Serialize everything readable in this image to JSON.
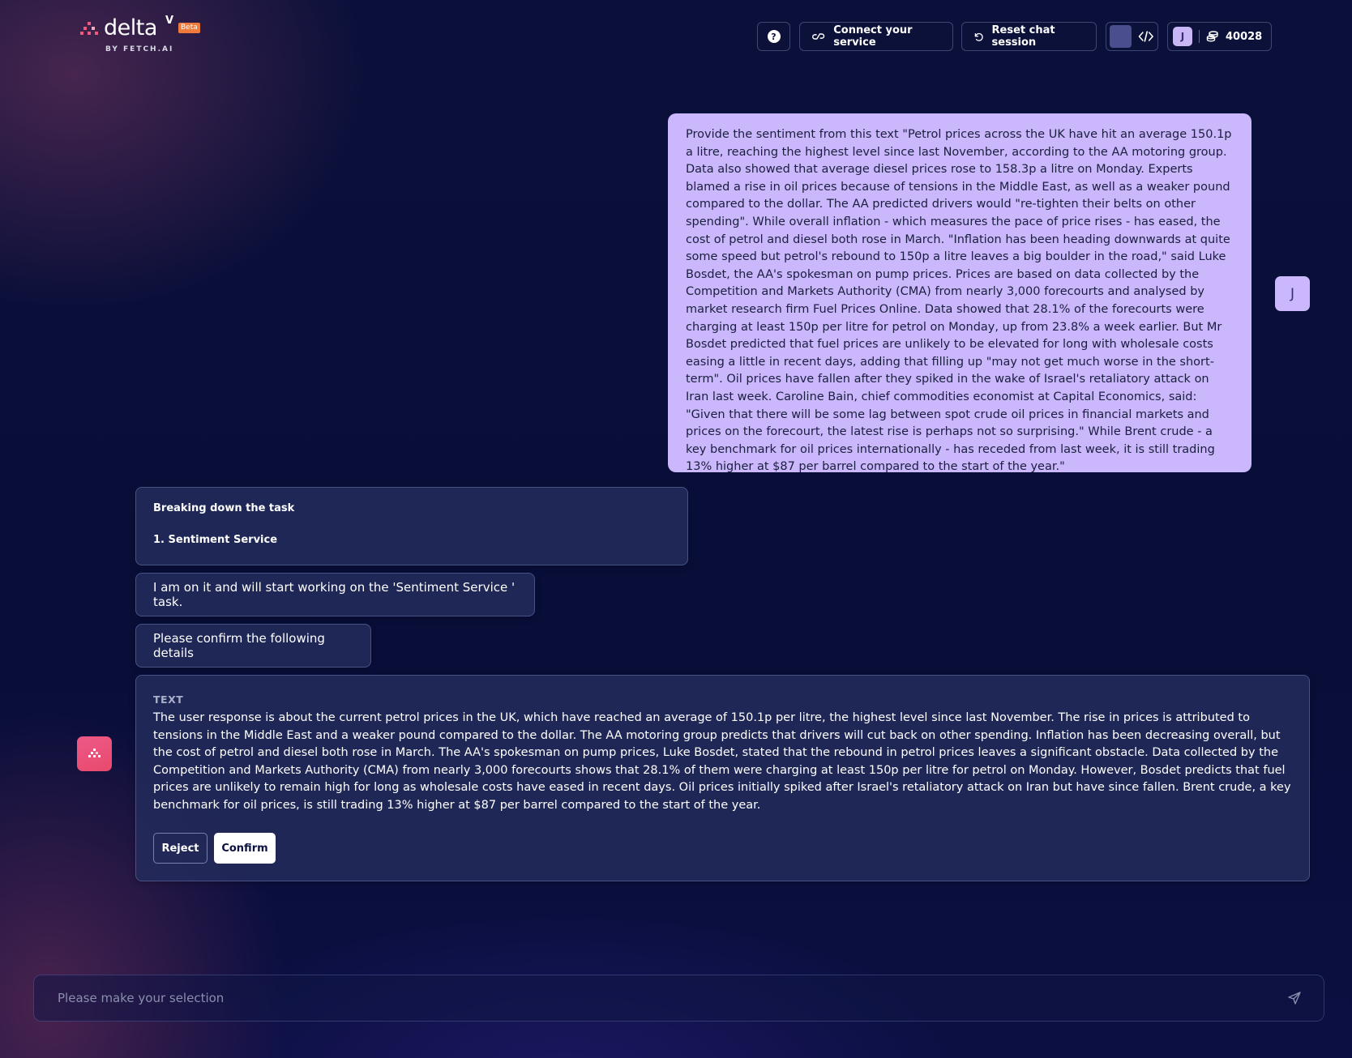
{
  "header": {
    "logo_word": "delta",
    "logo_sup": "V",
    "logo_badge": "Beta",
    "logo_byline": "BY FETCH.AI",
    "help_label": "?",
    "connect_label": "Connect your service",
    "reset_label": "Reset chat session",
    "user_initial": "J",
    "credits": "40028"
  },
  "conversation": {
    "user_message": "Provide the sentiment from this text \"Petrol prices across the UK have hit an average 150.1p a litre, reaching the highest level since last November, according to the AA motoring group. Data also showed that average diesel prices rose to 158.3p a litre on Monday. Experts blamed a rise in oil prices because of tensions in the Middle East, as well as a weaker pound compared to the dollar. The AA predicted drivers would \"re-tighten their belts on other spending\". While overall inflation - which measures the pace of price rises - has eased, the cost of petrol and diesel both rose in March. \"Inflation has been heading downwards at quite some speed but petrol's rebound to 150p a litre leaves a big boulder in the road,\" said Luke Bosdet, the AA's spokesman on pump prices. Prices are based on data collected by the Competition and Markets Authority (CMA) from nearly 3,000 forecourts and analysed by market research firm Fuel Prices Online. Data showed that 28.1% of the forecourts were charging at least 150p per litre for petrol on Monday, up from 23.8% a week earlier. But Mr Bosdet predicted that fuel prices are unlikely to be elevated for long with wholesale costs easing a little in recent days, adding that filling up \"may not get much worse in the short-term\". Oil prices have fallen after they spiked in the wake of Israel's retaliatory attack on Iran last week. Caroline Bain, chief commodities economist at Capital Economics, said: \"Given that there will be some lag between spot crude oil prices in financial markets and prices on the forecourt, the latest rise is perhaps not so surprising.\" While Brent crude - a key benchmark for oil prices internationally - has receded from last week, it is still trading 13% higher at $87 per barrel compared to the start of the year.\"",
    "user_avatar": "J",
    "breakdown_title": "Breaking down the task",
    "breakdown_item": "1. Sentiment Service",
    "working_message": "I am on it and will start working on the 'Sentiment Service ' task.",
    "confirm_prompt": "Please confirm the following details",
    "details_label": "TEXT",
    "details_text": "The user response is about the current petrol prices in the UK, which have reached an average of 150.1p per litre, the highest level since last November. The rise in prices is attributed to tensions in the Middle East and a weaker pound compared to the dollar. The AA motoring group predicts that drivers will cut back on other spending. Inflation has been decreasing overall, but the cost of petrol and diesel both rose in March. The AA's spokesman on pump prices, Luke Bosdet, stated that the rebound in petrol prices leaves a significant obstacle. Data collected by the Competition and Markets Authority (CMA) from nearly 3,000 forecourts shows that 28.1% of them were charging at least 150p per litre for petrol on Monday. However, Bosdet predicts that fuel prices are unlikely to remain high for long as wholesale costs have eased in recent days. Oil prices initially spiked after Israel's retaliatory attack on Iran but have since fallen. Brent crude, a key benchmark for oil prices, is still trading 13% higher at $87 per barrel compared to the start of the year.",
    "reject_label": "Reject",
    "confirm_label": "Confirm"
  },
  "input": {
    "placeholder": "Please make your selection"
  },
  "colors": {
    "user_bubble": "#cbb7fb",
    "agent_avatar": "#e9496e",
    "beta_badge": "#ee7a3c",
    "background": "#0a103a"
  },
  "icons": {
    "help": "question-circle-icon",
    "connect": "link-icon",
    "reset": "rotate-ccw-icon",
    "developer": "code-icon",
    "credits": "coins-icon",
    "send": "send-icon",
    "agent": "deltav-logo-icon"
  }
}
